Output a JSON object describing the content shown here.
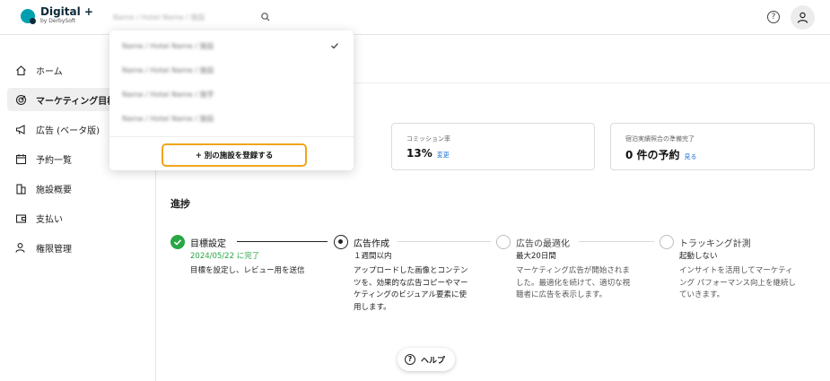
{
  "app": {
    "title": "Digital +",
    "subtitle": "by DerbySoft"
  },
  "header": {
    "property_name": "Name / Hotel Name / 施設"
  },
  "sidebar": {
    "items": [
      {
        "label": "ホーム",
        "icon": "home-icon"
      },
      {
        "label": "マーケティング目標",
        "icon": "target-icon",
        "active": true
      },
      {
        "label": "広告 (ベータ版)",
        "icon": "megaphone-icon"
      },
      {
        "label": "予約一覧",
        "icon": "calendar-icon"
      },
      {
        "label": "施設概要",
        "icon": "building-icon"
      },
      {
        "label": "支払い",
        "icon": "wallet-icon"
      },
      {
        "label": "権限管理",
        "icon": "user-settings-icon"
      }
    ]
  },
  "dropdown": {
    "options": [
      "Name / Hotel Name / 施設",
      "Name / Hotel Name / 施設",
      "Name / Hotel Name / 施字",
      "Name / Hotel Name / 施設"
    ],
    "register_label": "+ 別の施設を登録する"
  },
  "cards": [
    {
      "label": "コミッション率",
      "value": "13%",
      "link": "変更"
    },
    {
      "label": "宿泊実績照合の準備完了",
      "value": "0 件の予約",
      "link": "見る"
    }
  ],
  "progress": {
    "title": "進捗",
    "steps": [
      {
        "title": "目標設定",
        "sub": "2024/05/22 に完了",
        "desc": [
          "目標を設定し、レビュー用を送信"
        ],
        "state": "done"
      },
      {
        "title": "広告作成",
        "sub": "１週間以内",
        "desc": [
          "アップロードした画像とコンテン",
          "ツを、効果的な広告コピーやマー",
          "ケティングのビジュアル要素に使",
          "用します。"
        ],
        "state": "current"
      },
      {
        "title": "広告の最適化",
        "sub": "最大20日間",
        "desc": [
          "マーケティング広告が開始されま",
          "した。最適化を続けて、適切な視",
          "聴者に広告を表示します。"
        ],
        "state": "pending"
      },
      {
        "title": "トラッキング計測",
        "sub": "起動しない",
        "desc": [
          "インサイトを活用してマーケティ",
          "ング パフォーマンス向上を継続し",
          "ていきます。"
        ],
        "state": "pending"
      }
    ]
  },
  "help": {
    "label": "ヘルプ"
  },
  "colors": {
    "accent": "#00a0b0",
    "success": "#29a745",
    "link": "#1a6fd8",
    "highlight": "#f0a51a"
  }
}
